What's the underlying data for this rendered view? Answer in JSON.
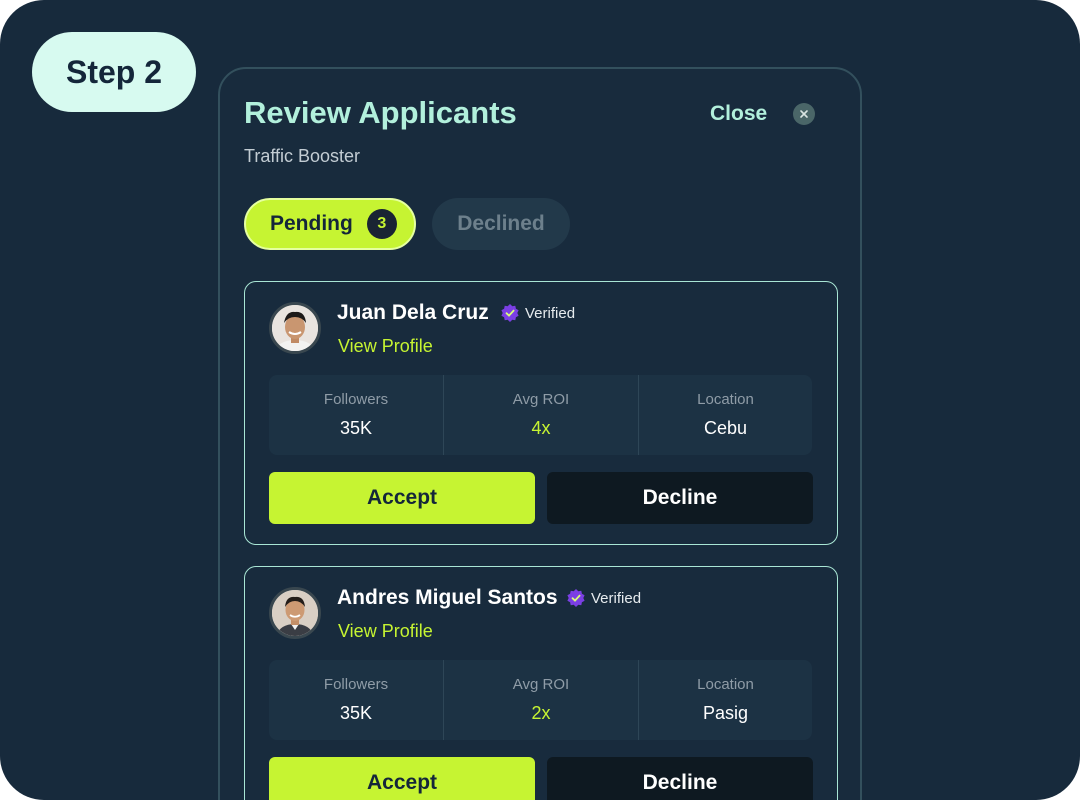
{
  "step_label": "Step 2",
  "panel": {
    "title": "Review Applicants",
    "subtitle": "Traffic Booster",
    "close_label": "Close"
  },
  "tabs": [
    {
      "label": "Pending",
      "count": "3",
      "active": true
    },
    {
      "label": "Declined",
      "active": false
    }
  ],
  "applicants": [
    {
      "name": "Juan Dela Cruz",
      "verified_label": "Verified",
      "view_profile": "View Profile",
      "stats": [
        {
          "label": "Followers",
          "value": "35K"
        },
        {
          "label": "Avg ROI",
          "value": "4x"
        },
        {
          "label": "Location",
          "value": "Cebu"
        }
      ],
      "accept_label": "Accept",
      "decline_label": "Decline"
    },
    {
      "name": "Andres Miguel Santos",
      "verified_label": "Verified",
      "view_profile": "View Profile",
      "stats": [
        {
          "label": "Followers",
          "value": "35K"
        },
        {
          "label": "Avg ROI",
          "value": "2x"
        },
        {
          "label": "Location",
          "value": "Pasig"
        }
      ],
      "accept_label": "Accept",
      "decline_label": "Decline"
    }
  ],
  "icons": {
    "close": "close-icon",
    "verified": "verified-badge-icon",
    "avatar": "avatar"
  },
  "colors": {
    "background": "#172a3c",
    "accent_lime": "#c6f432",
    "title_mint": "#b2f0dc",
    "step_badge": "#d7faf0",
    "decline_button": "#0e1921",
    "verified_purple": "#7b3fe4"
  }
}
